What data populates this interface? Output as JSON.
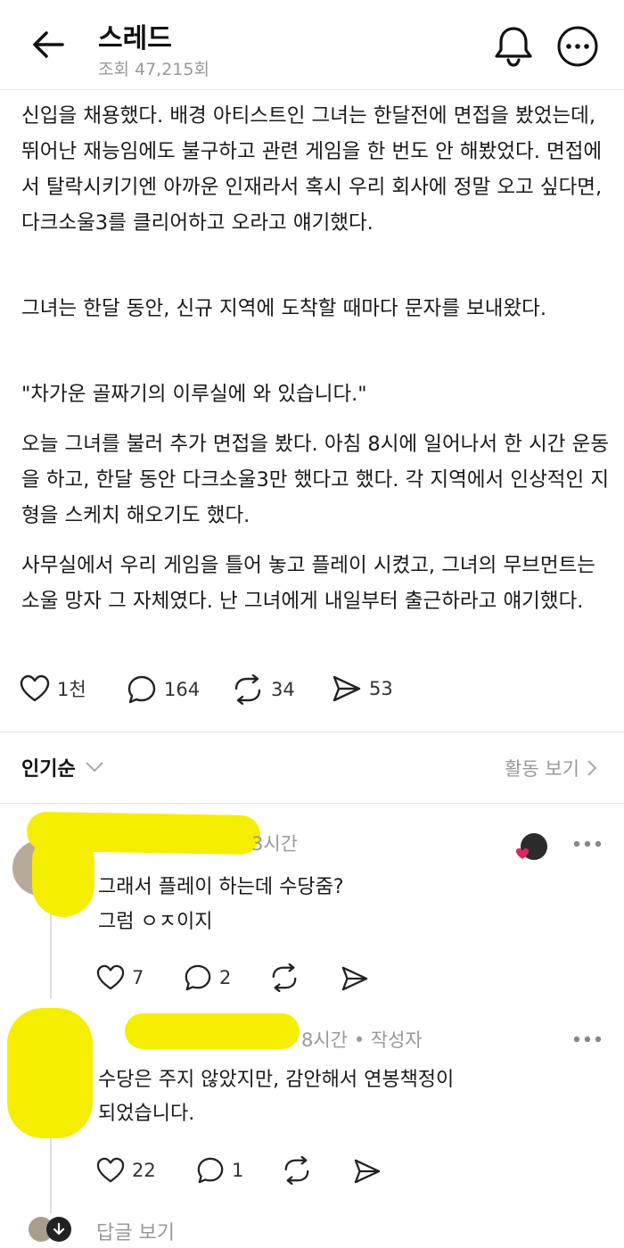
{
  "header": {
    "title": "스레드",
    "views": "조회 47,215회"
  },
  "post": {
    "paragraphs": [
      "신입을 채용했다. 배경 아티스트인 그녀는 한달전에 면접을 봤었는데, 뛰어난 재능임에도 불구하고 관련 게임을 한 번도 안 해봤었다. 면접에서 탈락시키기엔 아까운 인재라서 혹시 우리 회사에 정말 오고 싶다면, 다크소울3를 클리어하고 오라고 얘기했다.",
      "그녀는 한달 동안, 신규 지역에 도착할 때마다 문자를 보내왔다.",
      "\"차가운 골짜기의 이루실에 와 있습니다.\"",
      "오늘 그녀를 불러 추가 면접을 봤다. 아침 8시에 일어나서 한 시간 운동을 하고, 한달 동안 다크소울3만 했다고 했다. 각 지역에서 인상적인 지형을 스케치 해오기도 했다.",
      "사무실에서 우리 게임을 틀어 놓고 플레이 시켰고, 그녀의 무브먼트는 소울 망자 그 자체였다. 난 그녀에게 내일부터 출근하라고 얘기했다."
    ],
    "likes": "1천",
    "comments": "164",
    "reposts": "34",
    "shares": "53"
  },
  "sort": {
    "label": "인기순",
    "activity_link": "활동 보기"
  },
  "comments": [
    {
      "time": "3시간",
      "text_lines": [
        "그래서 플레이 하는데 수당줌?",
        "그럼 ㅇㅈ이지"
      ],
      "likes": "7",
      "replies": "2"
    },
    {
      "time": "8시간",
      "author_tag": "• 작성자",
      "text_lines": [
        "수당은 주지 않았지만, 감안해서 연봉책정이",
        "되었습니다."
      ],
      "likes": "22",
      "replies": "1"
    }
  ],
  "view_replies": "답글 보기",
  "colors": {
    "highlighter": "#f5ee00",
    "liked_heart": "#e0245e",
    "muted": "#999999"
  }
}
